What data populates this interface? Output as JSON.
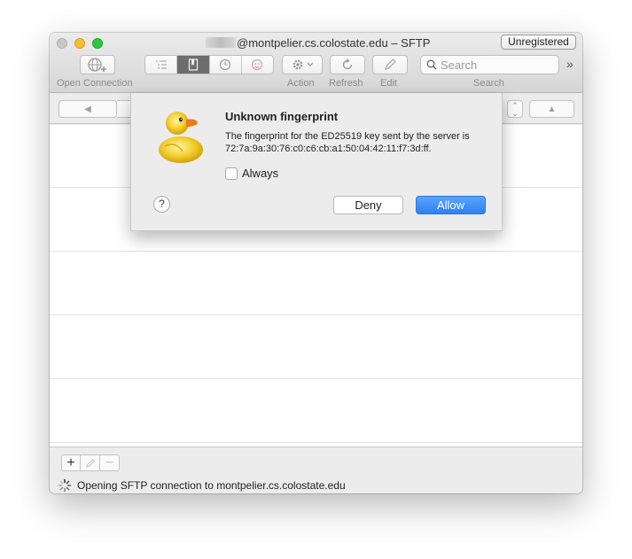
{
  "window": {
    "title": "@montpelier.cs.colostate.edu – SFTP",
    "badge": "Unregistered"
  },
  "toolbar": {
    "open_connection_label": "Open Connection",
    "action_label": "Action",
    "refresh_label": "Refresh",
    "edit_label": "Edit",
    "search_label": "Search",
    "search_placeholder": "Search",
    "view_modes": [
      "outline-view-icon",
      "bookmarks-icon",
      "history-icon",
      "bonjour-icon"
    ],
    "active_view_mode": "bookmarks-icon"
  },
  "dialog": {
    "title": "Unknown fingerprint",
    "message": "The fingerprint for the ED25519 key sent by the server is 72:7a:9a:30:76:c0:c6:cb:a1:50:04:42:11:f7:3d:ff.",
    "checkbox_label": "Always",
    "checkbox_checked": false,
    "deny_label": "Deny",
    "allow_label": "Allow",
    "help_label": "?"
  },
  "status": {
    "text": "Opening SFTP connection to montpelier.cs.colostate.edu"
  },
  "colors": {
    "accent": "#2e80f3",
    "close": "#c8c8c8",
    "minimize": "#f6be2f",
    "maximize": "#2bc840"
  }
}
